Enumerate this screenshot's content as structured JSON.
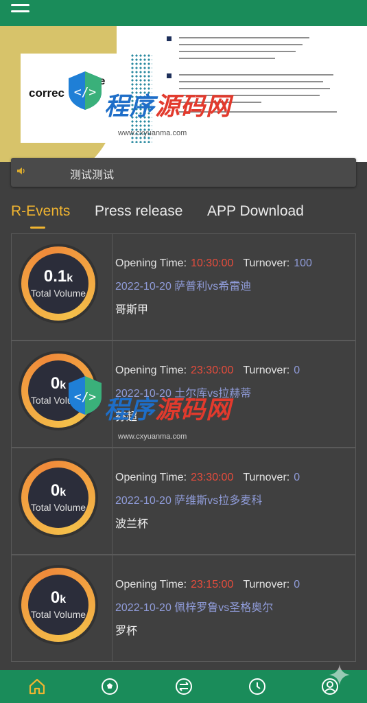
{
  "banner": {
    "slogan_left": "correc",
    "slogan_top": "ope"
  },
  "notice": {
    "text": "测试测试"
  },
  "tabs": [
    {
      "label": "R-Events",
      "active": true
    },
    {
      "label": "Press release",
      "active": false
    },
    {
      "label": "APP Download",
      "active": false
    }
  ],
  "labels": {
    "opening_time": "Opening Time:",
    "turnover": "Turnover:",
    "total_volume": "Total Volume"
  },
  "events": [
    {
      "volume": "0.1",
      "unit": "k",
      "time": "10:30:00",
      "turnover": "100",
      "match": "2022-10-20 萨普利vs希雷迪",
      "league": "哥斯甲"
    },
    {
      "volume": "0",
      "unit": "k",
      "time": "23:30:00",
      "turnover": "0",
      "match": "2022-10-20 土尔库vs拉赫蒂",
      "league": "芬超"
    },
    {
      "volume": "0",
      "unit": "k",
      "time": "23:30:00",
      "turnover": "0",
      "match": "2022-10-20 萨维斯vs拉多麦科",
      "league": "波兰杯"
    },
    {
      "volume": "0",
      "unit": "k",
      "time": "23:15:00",
      "turnover": "0",
      "match": "2022-10-20 佩梓罗鲁vs圣格奥尔",
      "league": "罗杯"
    }
  ],
  "watermark": {
    "text_a": "程序",
    "text_b": "源码网",
    "url": "www.cxyuanma.com"
  },
  "nav": [
    {
      "icon": "home-icon"
    },
    {
      "icon": "football-icon"
    },
    {
      "icon": "exchange-icon"
    },
    {
      "icon": "clock-icon"
    },
    {
      "icon": "user-icon"
    }
  ],
  "colors": {
    "brand_green": "#1a8c5a",
    "accent_gold": "#f0b430",
    "time_red": "#e74c3c",
    "link_blue": "#8f9bd8",
    "background": "#3f3f3f"
  }
}
